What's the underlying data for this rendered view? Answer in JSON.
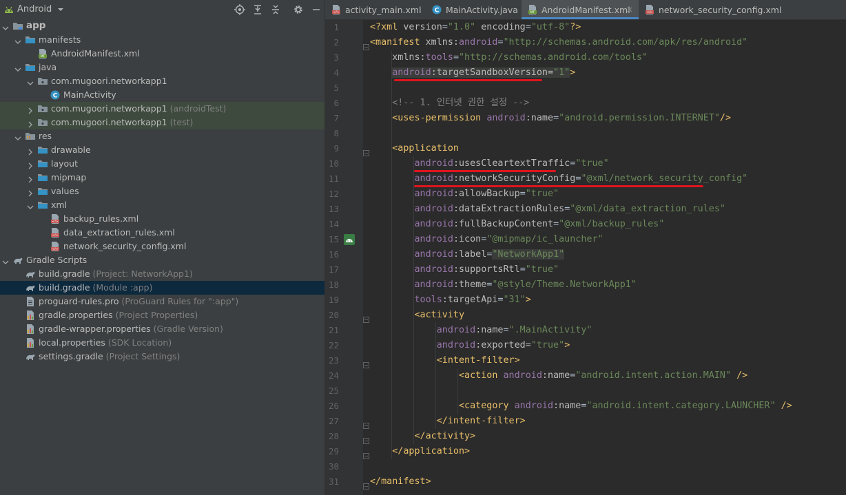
{
  "project_panel": {
    "title": "Android",
    "tree": [
      {
        "label": "app",
        "hint": "",
        "icon": "module-icon",
        "bold": true
      },
      {
        "label": "manifests",
        "hint": "",
        "icon": "folder-icon"
      },
      {
        "label": "AndroidManifest.xml",
        "hint": "",
        "icon": "manifest-file-icon"
      },
      {
        "label": "java",
        "hint": "",
        "icon": "folder-icon"
      },
      {
        "label": "com.mugoori.networkapp1",
        "hint": "",
        "icon": "package-icon"
      },
      {
        "label": "MainActivity",
        "hint": "",
        "icon": "class-icon"
      },
      {
        "label": "com.mugoori.networkapp1",
        "hint": "(androidTest)",
        "icon": "package-icon"
      },
      {
        "label": "com.mugoori.networkapp1",
        "hint": "(test)",
        "icon": "package-icon"
      },
      {
        "label": "res",
        "hint": "",
        "icon": "res-folder-icon"
      },
      {
        "label": "drawable",
        "hint": "",
        "icon": "folder-icon"
      },
      {
        "label": "layout",
        "hint": "",
        "icon": "folder-icon"
      },
      {
        "label": "mipmap",
        "hint": "",
        "icon": "folder-icon"
      },
      {
        "label": "values",
        "hint": "",
        "icon": "folder-icon"
      },
      {
        "label": "xml",
        "hint": "",
        "icon": "folder-icon"
      },
      {
        "label": "backup_rules.xml",
        "hint": "",
        "icon": "xml-file-icon"
      },
      {
        "label": "data_extraction_rules.xml",
        "hint": "",
        "icon": "xml-file-icon"
      },
      {
        "label": "network_security_config.xml",
        "hint": "",
        "icon": "xml-file-icon"
      },
      {
        "label": "Gradle Scripts",
        "hint": "",
        "icon": "gradle-icon"
      },
      {
        "label": "build.gradle",
        "hint": "(Project: NetworkApp1)",
        "icon": "gradle-icon"
      },
      {
        "label": "build.gradle",
        "hint": "(Module :app)",
        "icon": "gradle-icon"
      },
      {
        "label": "proguard-rules.pro",
        "hint": "(ProGuard Rules for \":app\")",
        "icon": "text-file-icon"
      },
      {
        "label": "gradle.properties",
        "hint": "(Project Properties)",
        "icon": "properties-file-icon"
      },
      {
        "label": "gradle-wrapper.properties",
        "hint": "(Gradle Version)",
        "icon": "properties-file-icon"
      },
      {
        "label": "local.properties",
        "hint": "(SDK Location)",
        "icon": "properties-file-icon"
      },
      {
        "label": "settings.gradle",
        "hint": "(Project Settings)",
        "icon": "gradle-icon"
      }
    ]
  },
  "editor": {
    "tabs": [
      {
        "label": "activity_main.xml",
        "icon": "xml-file-icon",
        "closable": false
      },
      {
        "label": "MainActivity.java",
        "icon": "class-icon",
        "closable": false
      },
      {
        "label": "AndroidManifest.xml",
        "icon": "manifest-file-icon",
        "closable": true
      },
      {
        "label": "network_security_config.xml",
        "icon": "xml-file-icon",
        "closable": false
      }
    ],
    "close_glyph": "×",
    "lines": [
      [
        [
          "punc",
          "<?"
        ],
        [
          "tag",
          "xml "
        ],
        [
          "attr",
          "version"
        ],
        [
          "plain",
          "="
        ],
        [
          "val",
          "\"1.0\""
        ],
        [
          "attr",
          " encoding"
        ],
        [
          "plain",
          "="
        ],
        [
          "val",
          "\"utf-8\""
        ],
        [
          "punc",
          "?>"
        ]
      ],
      [
        [
          "tag",
          "<manifest "
        ],
        [
          "attr",
          "xmlns:"
        ],
        [
          "ns",
          "android"
        ],
        [
          "plain",
          "="
        ],
        [
          "val",
          "\"http://schemas.android.com/apk/res/android\""
        ]
      ],
      [
        [
          "attr",
          "    xmlns:"
        ],
        [
          "ns",
          "tools"
        ],
        [
          "plain",
          "="
        ],
        [
          "val",
          "\"http://schemas.android.com/tools\""
        ]
      ],
      [
        [
          "plain",
          "    "
        ],
        [
          "nsh",
          "android"
        ],
        [
          "plainh",
          ":targetSandboxVersion"
        ],
        [
          "plainh",
          "="
        ],
        [
          "valh",
          "\"1\""
        ],
        [
          "tag",
          ">"
        ]
      ],
      [],
      [
        [
          "com",
          "    <!-- 1. 인터넷 권한 설정 -->"
        ]
      ],
      [
        [
          "tag",
          "    <uses-permission "
        ],
        [
          "ns",
          "android"
        ],
        [
          "attr",
          ":name"
        ],
        [
          "plain",
          "="
        ],
        [
          "val",
          "\"android.permission.INTERNET\""
        ],
        [
          "tag",
          "/>"
        ]
      ],
      [],
      [
        [
          "tag",
          "    <application"
        ]
      ],
      [
        [
          "ns",
          "        android"
        ],
        [
          "attr",
          ":usesCleartextTraffic"
        ],
        [
          "plain",
          "="
        ],
        [
          "val",
          "\"true\""
        ]
      ],
      [
        [
          "ns",
          "        android"
        ],
        [
          "attr",
          ":networkSecurityConfig"
        ],
        [
          "plain",
          "="
        ],
        [
          "val",
          "\"@xml/network_security_config\""
        ]
      ],
      [
        [
          "ns",
          "        android"
        ],
        [
          "attr",
          ":allowBackup"
        ],
        [
          "plain",
          "="
        ],
        [
          "val",
          "\"true\""
        ]
      ],
      [
        [
          "ns",
          "        android"
        ],
        [
          "attr",
          ":dataExtractionRules"
        ],
        [
          "plain",
          "="
        ],
        [
          "val",
          "\"@xml/data_extraction_rules\""
        ]
      ],
      [
        [
          "ns",
          "        android"
        ],
        [
          "attr",
          ":fullBackupContent"
        ],
        [
          "plain",
          "="
        ],
        [
          "val",
          "\"@xml/backup_rules\""
        ]
      ],
      [
        [
          "ns",
          "        android"
        ],
        [
          "attr",
          ":icon"
        ],
        [
          "plain",
          "="
        ],
        [
          "val",
          "\"@mipmap/ic_launcher\""
        ]
      ],
      [
        [
          "ns",
          "        android"
        ],
        [
          "attr",
          ":label"
        ],
        [
          "plain",
          "="
        ],
        [
          "valh",
          "\"NetworkApp1\""
        ]
      ],
      [
        [
          "ns",
          "        android"
        ],
        [
          "attr",
          ":supportsRtl"
        ],
        [
          "plain",
          "="
        ],
        [
          "val",
          "\"true\""
        ]
      ],
      [
        [
          "ns",
          "        android"
        ],
        [
          "attr",
          ":theme"
        ],
        [
          "plain",
          "="
        ],
        [
          "val",
          "\"@style/Theme.NetworkApp1\""
        ]
      ],
      [
        [
          "ns",
          "        tools"
        ],
        [
          "attr",
          ":targetApi"
        ],
        [
          "plain",
          "="
        ],
        [
          "val",
          "\"31\""
        ],
        [
          "tag",
          ">"
        ]
      ],
      [
        [
          "tag",
          "        <activity"
        ]
      ],
      [
        [
          "ns",
          "            android"
        ],
        [
          "attr",
          ":name"
        ],
        [
          "plain",
          "="
        ],
        [
          "val",
          "\".MainActivity\""
        ]
      ],
      [
        [
          "ns",
          "            android"
        ],
        [
          "attr",
          ":exported"
        ],
        [
          "plain",
          "="
        ],
        [
          "val",
          "\"true\""
        ],
        [
          "tag",
          ">"
        ]
      ],
      [
        [
          "tag",
          "            <intent-filter>"
        ]
      ],
      [
        [
          "tag",
          "                <action "
        ],
        [
          "ns",
          "android"
        ],
        [
          "attr",
          ":name"
        ],
        [
          "plain",
          "="
        ],
        [
          "val",
          "\"android.intent.action.MAIN\""
        ],
        [
          "tag",
          " />"
        ]
      ],
      [],
      [
        [
          "tag",
          "                <category "
        ],
        [
          "ns",
          "android"
        ],
        [
          "attr",
          ":name"
        ],
        [
          "plain",
          "="
        ],
        [
          "val",
          "\"android.intent.category.LAUNCHER\""
        ],
        [
          "tag",
          " />"
        ]
      ],
      [
        [
          "tag",
          "            </intent-filter>"
        ]
      ],
      [
        [
          "tag",
          "        </activity>"
        ]
      ],
      [
        [
          "tag",
          "    </application>"
        ]
      ],
      [],
      [
        [
          "tag",
          "</manifest>"
        ]
      ]
    ]
  },
  "colors": {
    "accent": "#4a88c7",
    "underline_red": "#e0141e",
    "selection": "#0d293e"
  }
}
